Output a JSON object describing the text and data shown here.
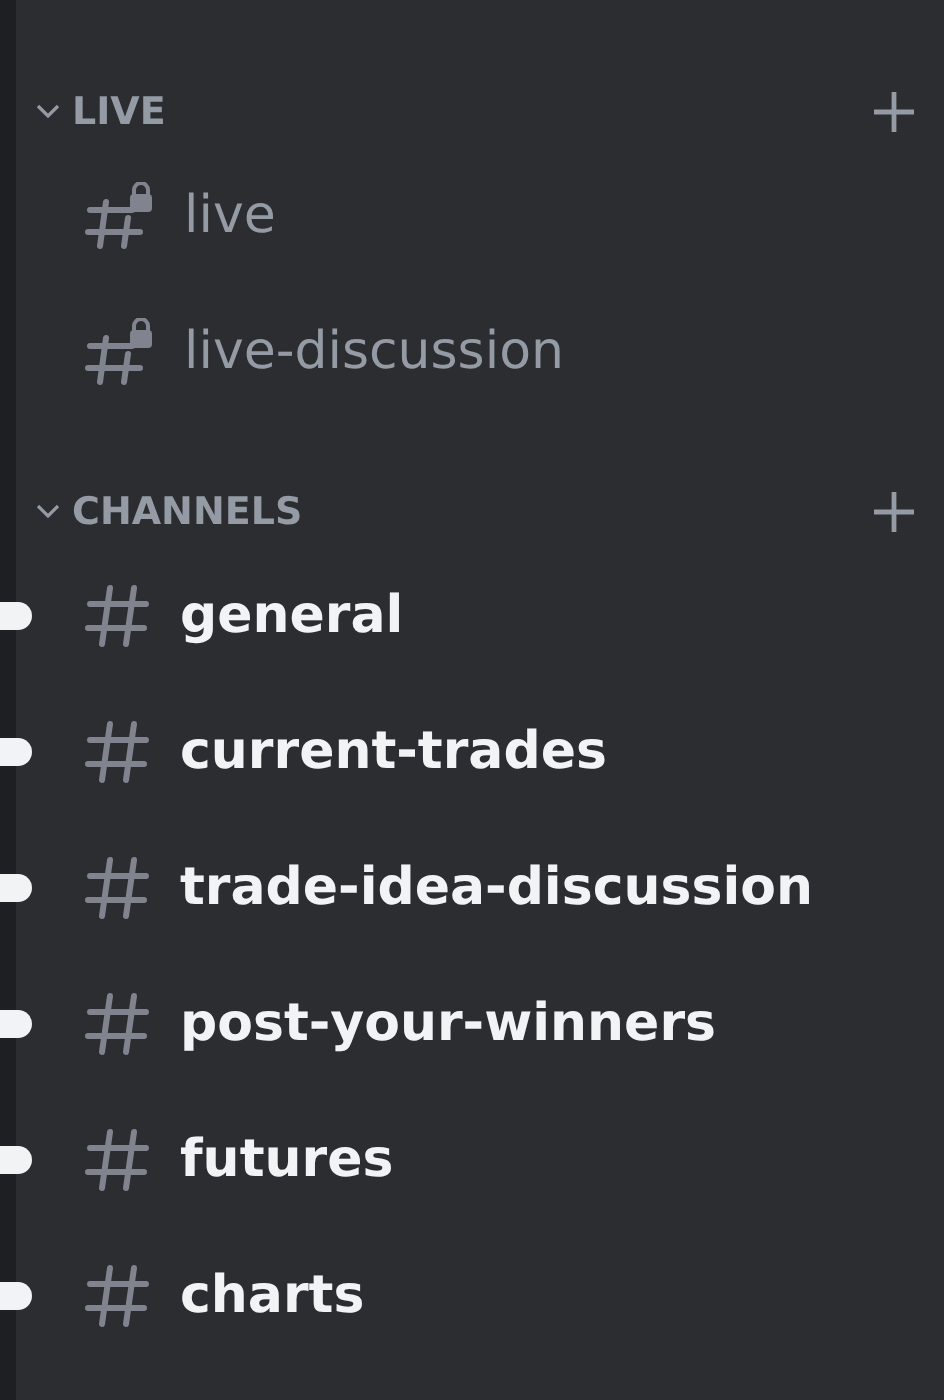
{
  "categories": [
    {
      "name": "LIVE",
      "expanded": true,
      "channels": [
        {
          "name": "live",
          "locked": true,
          "unread": false
        },
        {
          "name": "live-discussion",
          "locked": true,
          "unread": false
        }
      ]
    },
    {
      "name": "CHANNELS",
      "expanded": true,
      "channels": [
        {
          "name": "general",
          "locked": false,
          "unread": true
        },
        {
          "name": "current-trades",
          "locked": false,
          "unread": true
        },
        {
          "name": "trade-idea-discussion",
          "locked": false,
          "unread": true
        },
        {
          "name": "post-your-winners",
          "locked": false,
          "unread": true
        },
        {
          "name": "futures",
          "locked": false,
          "unread": true
        },
        {
          "name": "charts",
          "locked": false,
          "unread": true
        }
      ]
    }
  ]
}
